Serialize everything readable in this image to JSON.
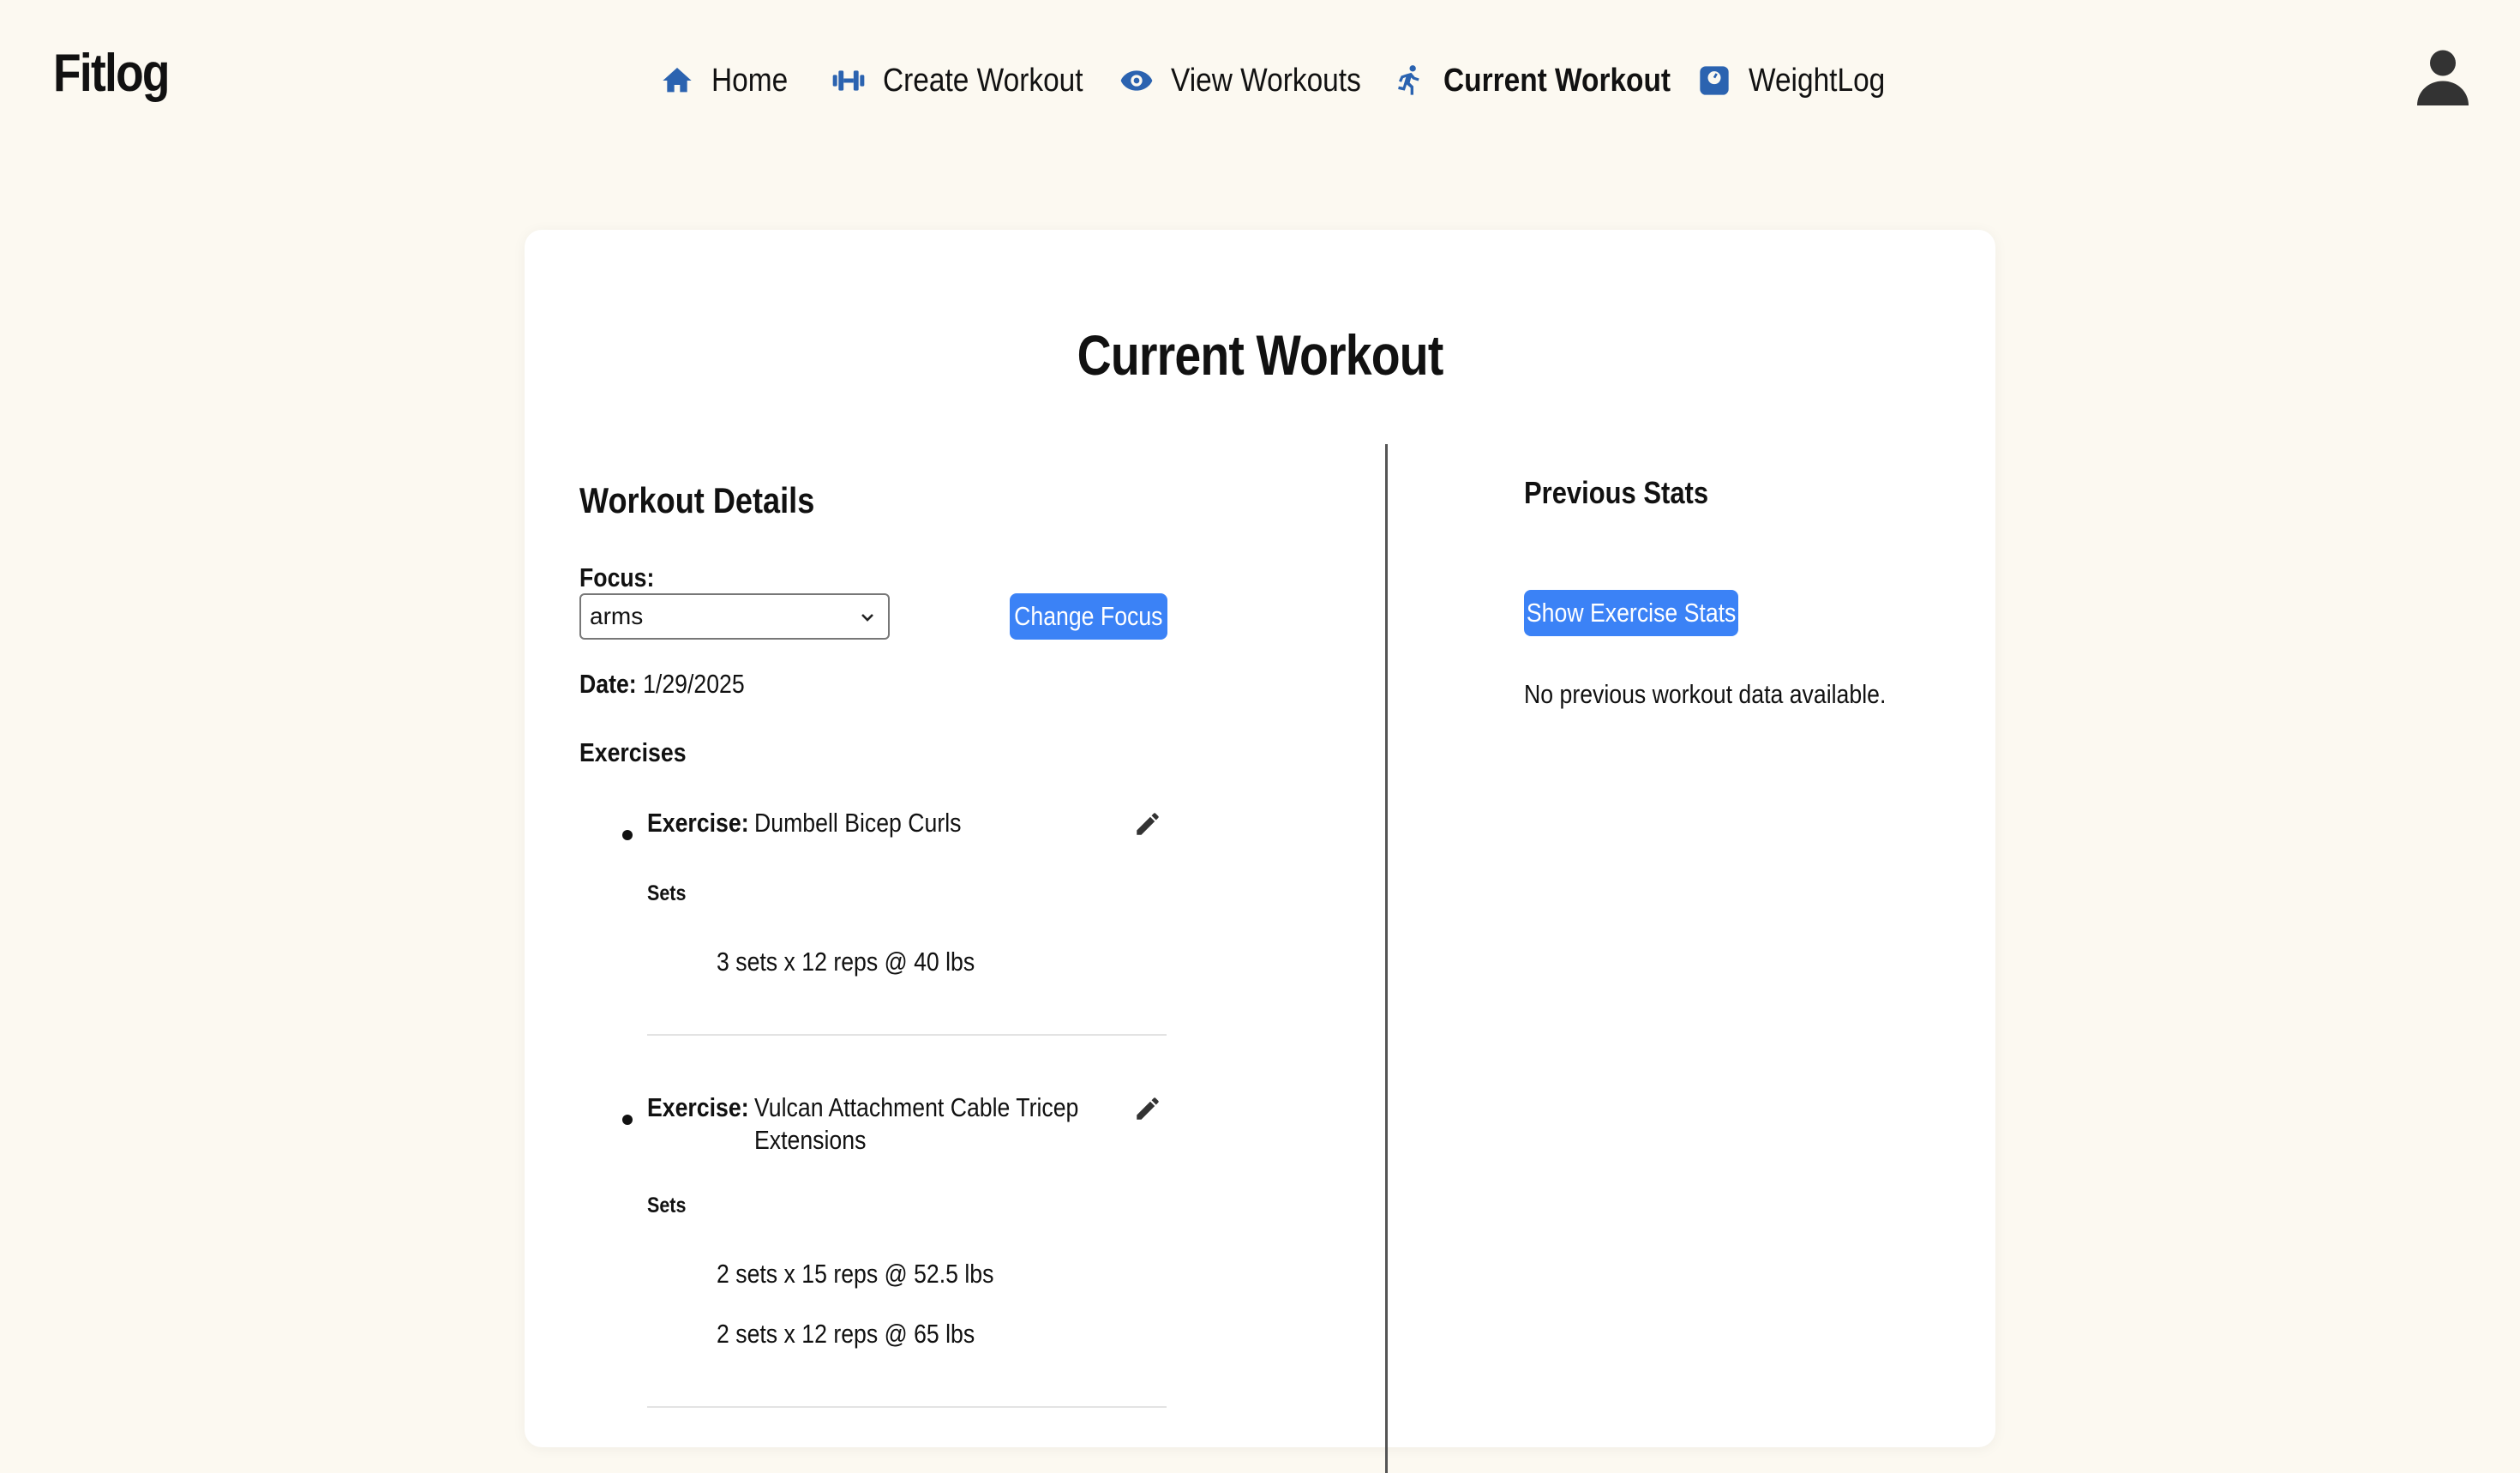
{
  "app": {
    "logo": "Fitlog"
  },
  "nav": {
    "home": "Home",
    "create_workout": "Create Workout",
    "view_workouts": "View Workouts",
    "current_workout": "Current Workout",
    "weight_log": "WeightLog",
    "active": "Current Workout",
    "icons": {
      "home": "home-icon",
      "create_workout": "dumbbell-icon",
      "view_workouts": "eye-icon",
      "current_workout": "running-person-icon",
      "weight_log": "scale-icon",
      "user": "user-icon"
    }
  },
  "colors": {
    "background": "#fcf9f1",
    "accent": "#3b82f6",
    "icon": "#2b63b0"
  },
  "page": {
    "title": "Current Workout"
  },
  "details": {
    "heading": "Workout Details",
    "focus_label": "Focus:",
    "focus_value": "arms",
    "change_focus_button": "Change Focus",
    "date_label": "Date:",
    "date_value": "1/29/2025",
    "exercises_heading": "Exercises",
    "exercise_label": "Exercise:",
    "sets_label": "Sets",
    "exercises": [
      {
        "name": "Dumbell Bicep Curls",
        "sets": [
          "3 sets x 12 reps @ 40 lbs"
        ]
      },
      {
        "name_line1": "Vulcan Attachment Cable Tricep",
        "name_line2": "Extensions",
        "sets": [
          "2 sets x 15 reps @ 52.5 lbs",
          "2 sets x 12 reps @ 65 lbs"
        ]
      }
    ]
  },
  "stats": {
    "heading": "Previous Stats",
    "show_button": "Show Exercise Stats",
    "empty_message": "No previous workout data available."
  }
}
